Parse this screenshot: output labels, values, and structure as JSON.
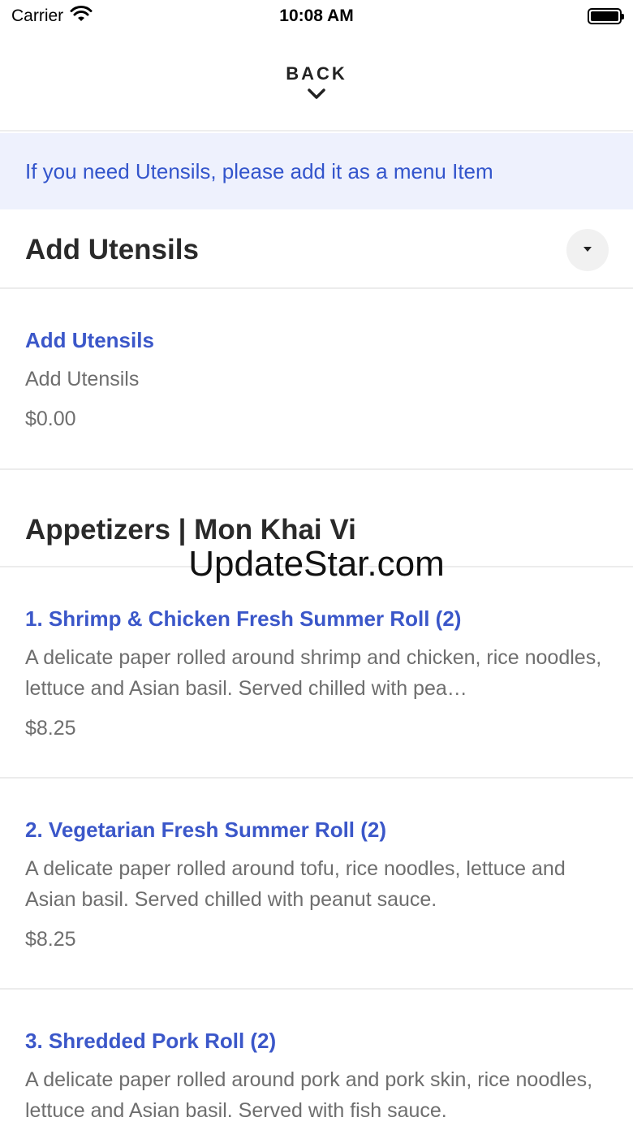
{
  "status_bar": {
    "carrier": "Carrier",
    "time": "10:08 AM"
  },
  "header": {
    "back_label": "BACK"
  },
  "notice": {
    "text": "If you need Utensils, please add it as a menu Item"
  },
  "sections": [
    {
      "title": "Add Utensils",
      "items": [
        {
          "name": "Add Utensils",
          "description": "Add Utensils",
          "price": "$0.00"
        }
      ]
    },
    {
      "title": "Appetizers | Mon Khai Vi",
      "items": [
        {
          "name": "1. Shrimp & Chicken Fresh Summer Roll (2)",
          "description": "A delicate paper rolled around shrimp and chicken, rice noodles, lettuce and  Asian basil. Served chilled with pea…",
          "price": "$8.25"
        },
        {
          "name": "2. Vegetarian Fresh Summer Roll (2)",
          "description": "A delicate paper rolled around tofu, rice noodles, lettuce and Asian basil. Served chilled with peanut sauce.",
          "price": "$8.25"
        },
        {
          "name": "3. Shredded Pork Roll (2)",
          "description": "A delicate paper rolled around pork and pork skin, rice noodles, lettuce and Asian basil. Served with fish sauce."
        }
      ]
    }
  ],
  "watermark": "UpdateStar.com"
}
